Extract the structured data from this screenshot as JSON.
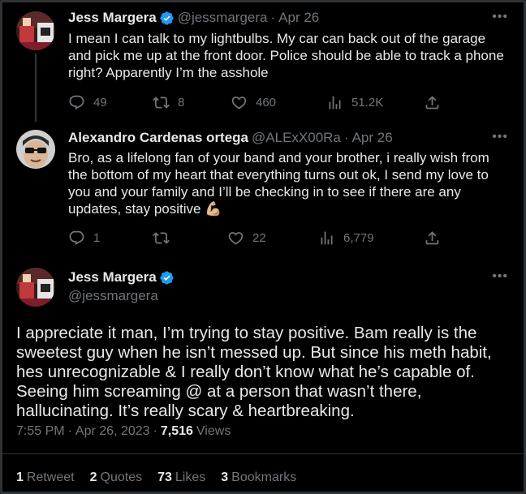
{
  "tweet1": {
    "name": "Jess Margera",
    "handle": "@jessmargera",
    "date": "Apr 26",
    "text": "I mean I can talk to my lightbulbs. My car can back out of the garage and pick me up at the front door. Police should be able to track a phone right? Apparently I’m the asshole",
    "replies": "49",
    "retweets": "8",
    "likes": "460",
    "views": "51.2K"
  },
  "tweet2": {
    "name": "Alexandro Cardenas ortega",
    "handle": "@ALExX00Ra",
    "date": "Apr 26",
    "text": "Bro, as a lifelong fan of your band and your brother, i really wish from the bottom of my heart that everything turns out ok, I send my love to you and your family and I’ll be checking in to see if there are any updates, stay positive",
    "emoji": "💪🏼",
    "replies": "1",
    "retweets": "",
    "likes": "22",
    "views": "6,779"
  },
  "main": {
    "name": "Jess Margera",
    "handle": "@jessmargera",
    "text": "I appreciate it man, I’m trying to stay positive. Bam really is the sweetest guy when he isn’t messed up. But since his meth habit, hes unrecognizable & I really don’t know what he’s capable of. Seeing him screaming @ at a person that wasn’t there, hallucinating. It’s really scary & heartbreaking.",
    "time": "7:55 PM",
    "date": "Apr 26, 2023",
    "views_count": "7,516",
    "views_label": "Views",
    "stats": [
      {
        "count": "1",
        "label": "Retweet"
      },
      {
        "count": "2",
        "label": "Quotes"
      },
      {
        "count": "73",
        "label": "Likes"
      },
      {
        "count": "3",
        "label": "Bookmarks"
      }
    ]
  },
  "colors": {
    "background": "#000000",
    "text": "#e7e9ea",
    "secondary": "#71767b",
    "verified": "#1d9bf0",
    "divider": "#2f3336"
  },
  "icons": [
    "verified-badge-icon",
    "reply-icon",
    "retweet-icon",
    "like-icon",
    "views-icon",
    "share-icon",
    "more-icon"
  ]
}
